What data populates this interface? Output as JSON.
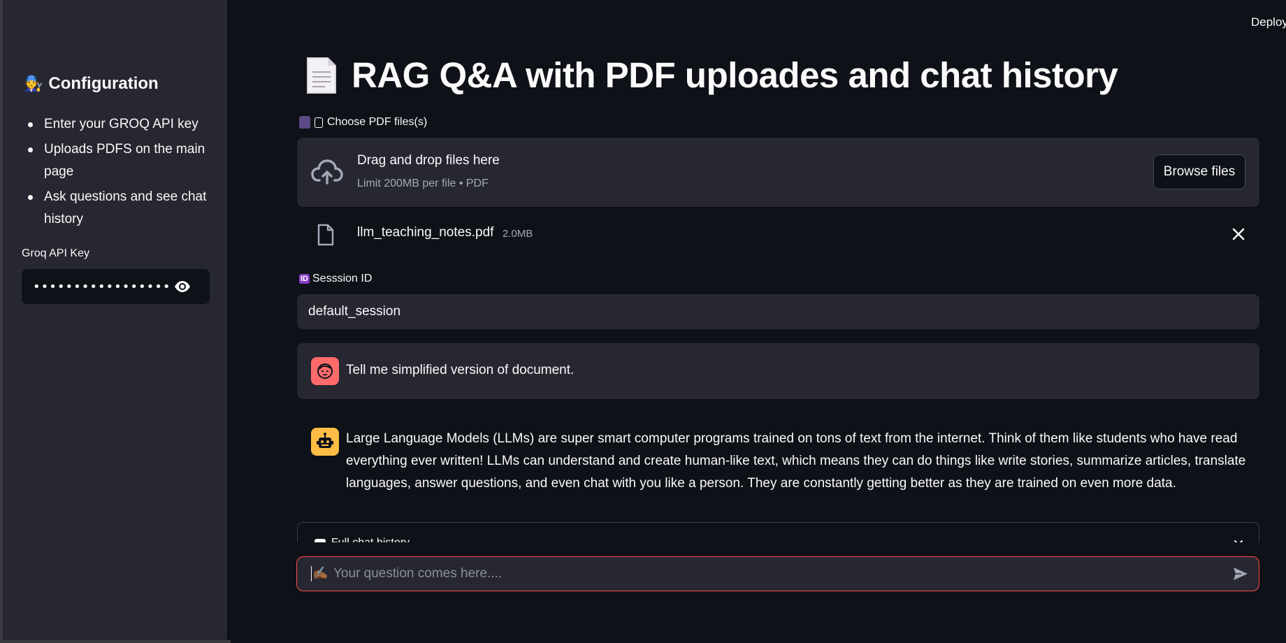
{
  "sidebar": {
    "title": "Configuration",
    "title_emoji": "🧑‍🔧",
    "instructions": [
      "Enter your GROQ API key",
      "Uploads PDFS on the main page",
      "Ask questions and see chat history"
    ],
    "api_key_label": "Groq API Key",
    "api_key_value": "••••••••••••••••••••••••••••••"
  },
  "header": {
    "deploy_label": "Deploy"
  },
  "main": {
    "title": "RAG Q&A with PDF uploades and chat history",
    "uploader": {
      "label": "Choose PDF files(s)",
      "drop_text": "Drag and drop files here",
      "limit_text": "Limit 200MB per file • PDF",
      "browse_label": "Browse files"
    },
    "file": {
      "name": "llm_teaching_notes.pdf",
      "size": "2.0MB"
    },
    "session": {
      "label": "Sesssion ID",
      "badge": "ID",
      "value": "default_session"
    },
    "messages": [
      {
        "role": "user",
        "text": "Tell me simplified version of document."
      },
      {
        "role": "assistant",
        "text": "Large Language Models (LLMs) are super smart computer programs trained on tons of text from the internet. Think of them like students who have read everything ever written! LLMs can understand and create human-like text, which means they can do things like write stories, summarize articles, translate languages, answer questions, and even chat with you like a person. They are constantly getting better as they are trained on even more data."
      }
    ],
    "history_label": "Full chat history",
    "chat_input": {
      "placeholder": "Your question comes here....",
      "emoji": "✍🏾"
    }
  },
  "colors": {
    "background": "#0e1117",
    "sidebar": "#262730",
    "accent": "#ff4b4b",
    "user_avatar": "#ff6b6b",
    "bot_avatar": "#ffbd45"
  }
}
